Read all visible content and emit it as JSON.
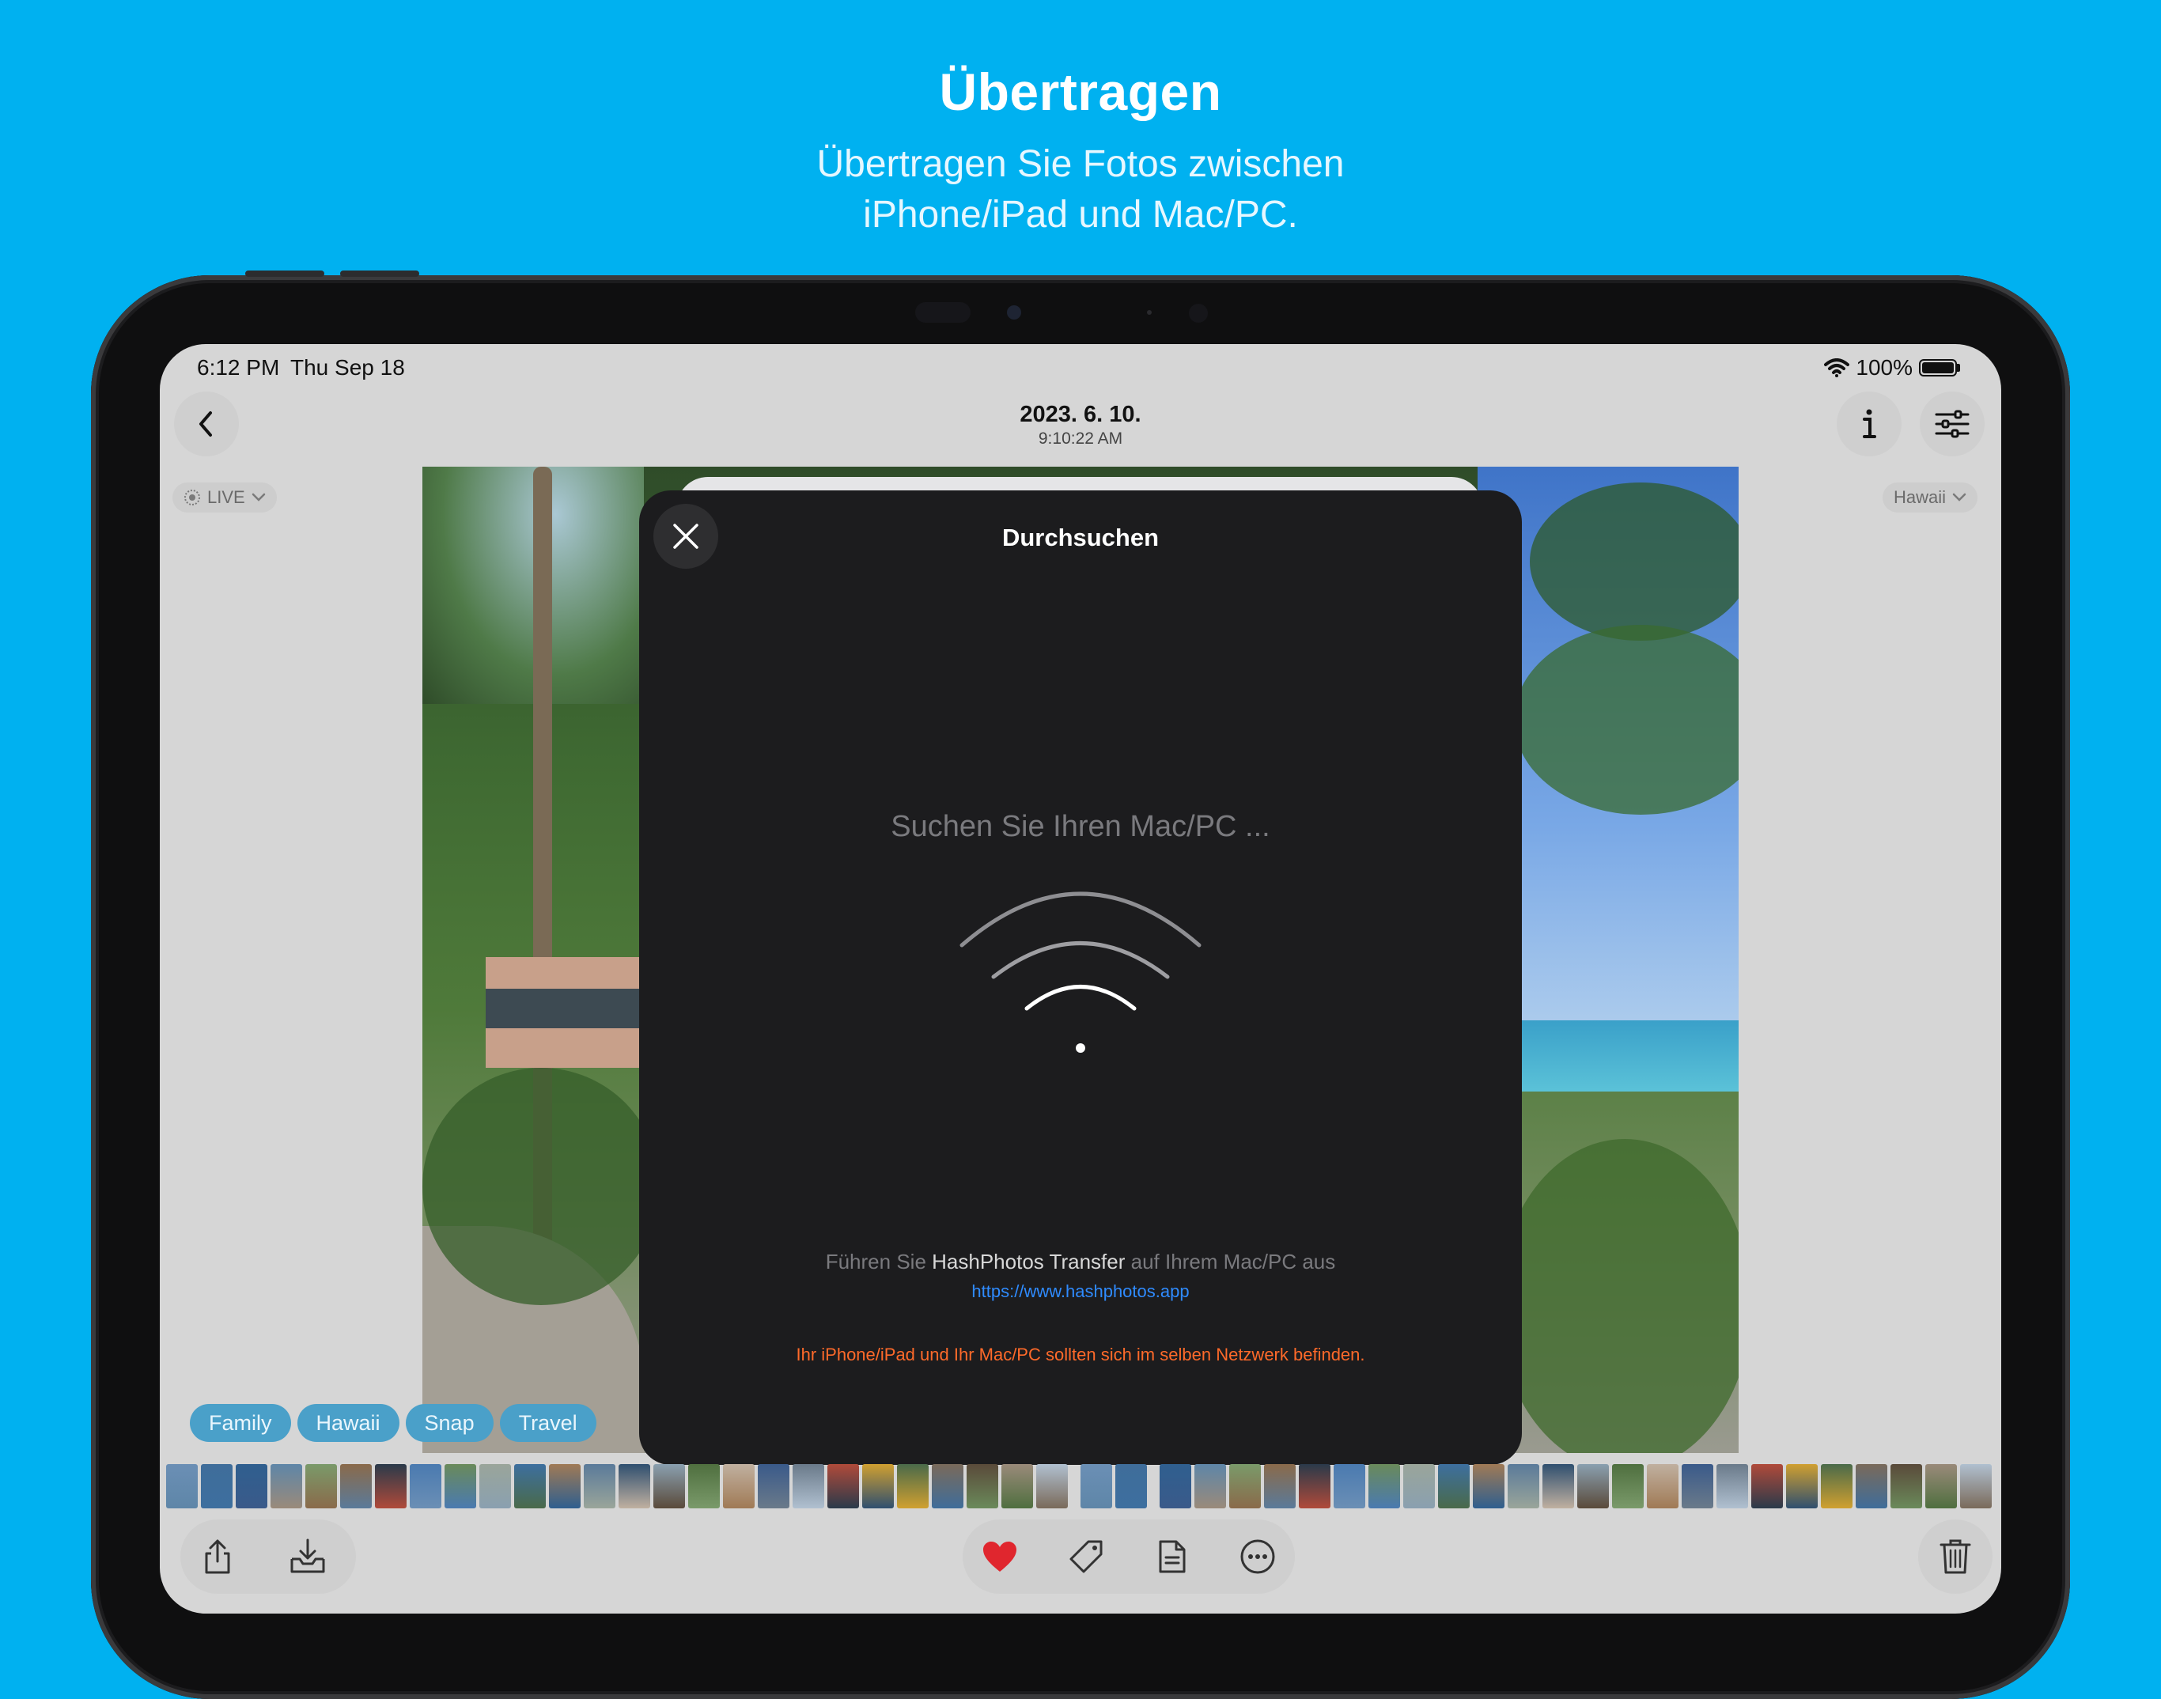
{
  "promo": {
    "title": "Übertragen",
    "subtitle_line1": "Übertragen Sie Fotos zwischen",
    "subtitle_line2": "iPhone/iPad und Mac/PC."
  },
  "status_bar": {
    "time": "6:12 PM",
    "date": "Thu Sep 18",
    "battery": "100%"
  },
  "nav": {
    "title": "2023. 6. 10.",
    "subtitle": "9:10:22 AM",
    "live_label": "LIVE",
    "album_label": "Hawaii"
  },
  "modal": {
    "title": "Durchsuchen",
    "searching_text": "Suchen Sie Ihren Mac/PC ...",
    "run_prefix": "Führen Sie",
    "run_app": "HashPhotos Transfer",
    "run_suffix": "auf Ihrem Mac/PC aus",
    "link": "https://www.hashphotos.app",
    "warning": "Ihr iPhone/iPad und Ihr Mac/PC sollten sich im selben Netzwerk befinden."
  },
  "tags": [
    "Family",
    "Hawaii",
    "Snap",
    "Travel"
  ],
  "icons": {
    "back": "chevron-left-icon",
    "info": "info-icon",
    "adjust": "sliders-icon",
    "close": "close-icon",
    "share": "share-icon",
    "download": "download-icon",
    "favorite": "heart-icon",
    "tag": "tag-icon",
    "document": "document-icon",
    "more": "more-icon",
    "trash": "trash-icon"
  },
  "colors": {
    "background": "#00b1f0",
    "tag": "#4aa0c9",
    "link": "#2f8bff",
    "warning": "#ff6a2a",
    "heart": "#e0262e",
    "modal": "#1c1c1e"
  }
}
